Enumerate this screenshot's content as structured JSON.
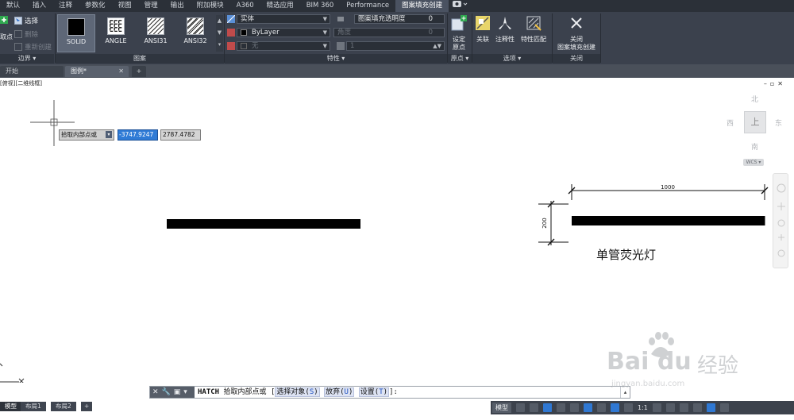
{
  "menu": {
    "tabs": [
      "默认",
      "插入",
      "注释",
      "参数化",
      "视图",
      "管理",
      "输出",
      "附加模块",
      "A360",
      "精选应用",
      "BIM 360",
      "Performance",
      "图案填充创建"
    ],
    "active_tab": "图案填充创建"
  },
  "ribbon": {
    "boundary": {
      "pick_points": "取点",
      "select": "选择",
      "remove": "删除",
      "recreate": "重新创建",
      "panel_label": "边界 ▾"
    },
    "pattern": {
      "items": [
        "SOLID",
        "ANGLE",
        "ANSI31",
        "ANSI32"
      ],
      "selected": "SOLID",
      "panel_label": "图案"
    },
    "properties": {
      "type_value": "实体",
      "color_value": "ByLayer",
      "bg_value": "无",
      "transparency_label": "图案填充透明度",
      "transparency_value": "0",
      "angle_label": "角度",
      "angle_value": "0",
      "scale_value": "1",
      "panel_label": "特性 ▾"
    },
    "origin": {
      "set_origin": "设定\n原点",
      "panel_label": "原点 ▾"
    },
    "options": {
      "associative": "关联",
      "annotative": "注释性",
      "match": "特性匹配",
      "panel_label": "选项 ▾"
    },
    "close": {
      "label": "关闭\n图案填充创建",
      "panel_label": "关闭"
    }
  },
  "doc_tabs": {
    "start": "开始",
    "drawing": "图例*"
  },
  "canvas": {
    "view_label": "[俯视][二维线框]",
    "prompt_label": "拾取内部点或",
    "input_x": "-3747.9247",
    "input_y": "2787.4782",
    "compass": {
      "north": "北",
      "south": "南",
      "east": "东",
      "west": "西",
      "top": "上",
      "wcs": "WCS ▾"
    },
    "dim_horizontal": "1000",
    "dim_vertical": "200",
    "annotation": "单管荧光灯"
  },
  "command_line": {
    "command": "HATCH",
    "prompt": "拾取内部点或",
    "options": [
      {
        "text": "选择对象",
        "key": "S"
      },
      {
        "text": "放弃",
        "key": "U"
      },
      {
        "text": "设置",
        "key": "T"
      }
    ]
  },
  "status": {
    "layout_tabs": [
      "模型",
      "布局1",
      "布局2"
    ],
    "model_label": "模型",
    "scale": "1:1"
  },
  "watermark": {
    "brand": "Bai du",
    "cn": "经验",
    "url": "jingyan.baidu.com"
  },
  "colors": {
    "ribbon_bg": "#3b414d",
    "menubar_bg": "#2b3038",
    "accent_blue": "#2f7bd6"
  }
}
